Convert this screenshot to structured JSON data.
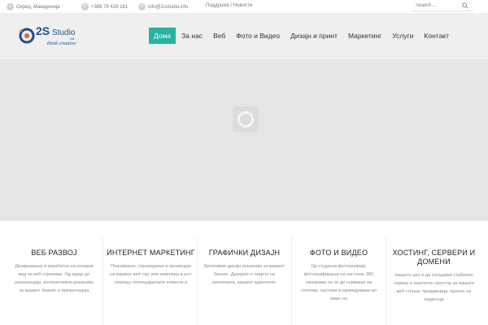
{
  "topbar": {
    "location": "Охрид, Македонија",
    "phone": "+389 78 428 181",
    "email": "info@2sstudio.info",
    "link_support": "Поддршка",
    "link_sep": "/",
    "link_news": "Новости",
    "search_placeholder": "Search ..."
  },
  "logo": {
    "brand": "2S",
    "word": "Studio",
    "tagline": "think creative",
    "tld": ".info"
  },
  "nav": {
    "items": [
      {
        "label": "Дома"
      },
      {
        "label": "За нас"
      },
      {
        "label": "Веб"
      },
      {
        "label": "Фото и Видео"
      },
      {
        "label": "Дизајн и принт"
      },
      {
        "label": "Маркетинг"
      },
      {
        "label": "Услуги"
      },
      {
        "label": "Контакт"
      }
    ]
  },
  "services": [
    {
      "title": "ВЕБ РАЗВОЈ",
      "text": "Дизајнирање и изработка на секаков вид на веб страници. Од идеја до реализација, интерактивни решенија за вашиот бизнис и презентација"
    },
    {
      "title": "ИНТЕРНЕТ МАРКЕТИНГ",
      "text": "Планирање, спроведење и промоција на вашиот веб сајт или кампања в јост помошу потенцијалните клиенти и"
    },
    {
      "title": "ГРАФИЧКИ ДИЗАЈН",
      "text": "Креативни дизајн решенија за вашиот бизнис. Дизајнот е лицето на реклемата, вашиот идентитет."
    },
    {
      "title": "ФОТО И ВИДЕО",
      "text": "Од студиска фотографија, фотографирање на настани, 360 панорами па се до снимање на спотови, настани и приведување во живо на"
    },
    {
      "title": "ХОСТИНГ, СЕРВЕРИ И ДОМЕНИ",
      "text": "Нашата цел е да понудиме стабилен сервер и заштитен простор за вашата веб страна, продавница, пренос на податоци"
    }
  ],
  "colors": {
    "accent": "#26b3a0",
    "logo_blue": "#1f4f8a",
    "logo_orange": "#e8642c"
  }
}
